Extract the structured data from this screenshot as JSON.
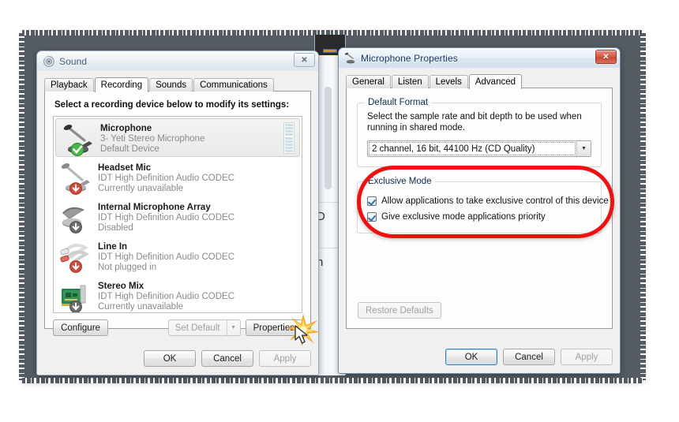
{
  "backdrop": {
    "color": "#555b63"
  },
  "hidden_window": {
    "fragment_1": "D",
    "fragment_2": "h"
  },
  "sound_dialog": {
    "title": "Sound",
    "title_icon": "speaker-icon",
    "close_label": "✕",
    "tabs": [
      {
        "label": "Playback",
        "active": false
      },
      {
        "label": "Recording",
        "active": true
      },
      {
        "label": "Sounds",
        "active": false
      },
      {
        "label": "Communications",
        "active": false
      }
    ],
    "prompt": "Select a recording device below to modify its settings:",
    "devices": [
      {
        "name": "Microphone",
        "driver": "3- Yeti Stereo Microphone",
        "status": "Default Device",
        "icon": "desk-microphone-icon",
        "badge": "green-check-badge",
        "selected": true,
        "meter_bars": 9
      },
      {
        "name": "Headset Mic",
        "driver": "IDT High Definition Audio CODEC",
        "status": "Currently unavailable",
        "icon": "desk-microphone-icon",
        "badge": "red-down-arrow-badge",
        "selected": false
      },
      {
        "name": "Internal Microphone Array",
        "driver": "IDT High Definition Audio CODEC",
        "status": "Disabled",
        "icon": "microphone-array-icon",
        "badge": "gray-down-arrow-badge",
        "selected": false
      },
      {
        "name": "Line In",
        "driver": "IDT High Definition Audio CODEC",
        "status": "Not plugged in",
        "icon": "rca-cable-icon",
        "badge": "red-down-arrow-badge",
        "selected": false
      },
      {
        "name": "Stereo Mix",
        "driver": "IDT High Definition Audio CODEC",
        "status": "Currently unavailable",
        "icon": "sound-card-icon",
        "badge": "gray-down-arrow-badge",
        "selected": false
      }
    ],
    "configure_label": "Configure",
    "set_default_label": "Set Default",
    "set_default_disabled": true,
    "properties_label": "Properties",
    "ok_label": "OK",
    "cancel_label": "Cancel",
    "apply_label": "Apply",
    "apply_disabled": true
  },
  "mic_dialog": {
    "title": "Microphone Properties",
    "title_icon": "desk-microphone-icon",
    "close_label": "✕",
    "tabs": [
      {
        "label": "General",
        "active": false
      },
      {
        "label": "Listen",
        "active": false
      },
      {
        "label": "Levels",
        "active": false
      },
      {
        "label": "Advanced",
        "active": true
      }
    ],
    "default_format": {
      "group_title": "Default Format",
      "description": "Select the sample rate and bit depth to be used when running in shared mode.",
      "selected_value": "2 channel, 16 bit, 44100 Hz (CD Quality)",
      "arrow_icon": "chevron-down-icon"
    },
    "exclusive_mode": {
      "group_title": "Exclusive Mode",
      "checkboxes": [
        {
          "label": "Allow applications to take exclusive control of this device",
          "checked": true
        },
        {
          "label": "Give exclusive mode applications priority",
          "checked": true
        }
      ]
    },
    "restore_defaults_label": "Restore Defaults",
    "restore_defaults_disabled": true,
    "ok_label": "OK",
    "cancel_label": "Cancel",
    "apply_label": "Apply",
    "apply_disabled": true
  },
  "annotations": {
    "highlight_color": "#ee1111",
    "highlight_target": "Exclusive Mode group",
    "click_target": "Properties button",
    "click_fx": "orange-starburst",
    "cursor": "arrow-pointer"
  }
}
